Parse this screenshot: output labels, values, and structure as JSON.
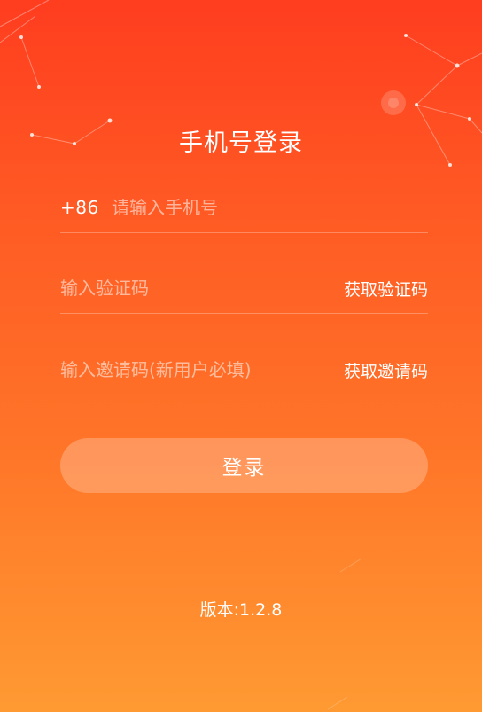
{
  "colors": {
    "background_top": "#ff3d1f",
    "background_bottom": "#ff9a32",
    "text": "#ffffff"
  },
  "header": {
    "title": "手机号登录"
  },
  "form": {
    "phone": {
      "country_code": "+86",
      "placeholder": "请输入手机号",
      "value": ""
    },
    "verification": {
      "placeholder": "输入验证码",
      "value": "",
      "action_label": "获取验证码"
    },
    "invite": {
      "placeholder": "输入邀请码(新用户必填)",
      "value": "",
      "action_label": "获取邀请码"
    },
    "submit_label": "登录"
  },
  "footer": {
    "version": "版本:1.2.8"
  }
}
